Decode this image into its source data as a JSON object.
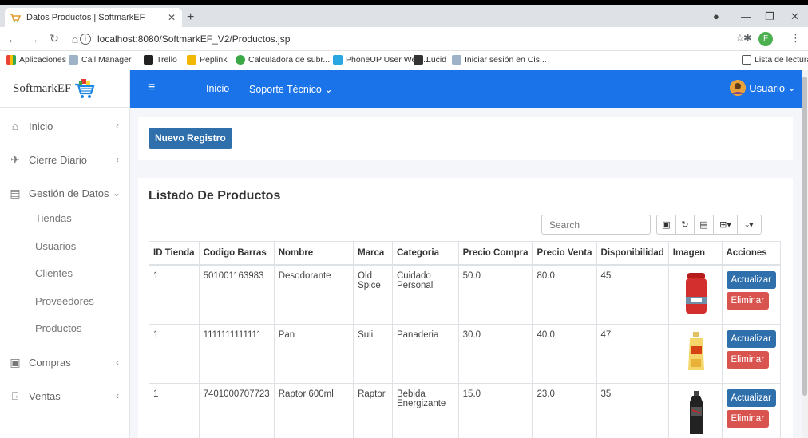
{
  "browser": {
    "tab_title": "Datos Productos | SoftmarkEF",
    "url": "localhost:8080/SoftmarkEF_V2/Productos.jsp",
    "profile_initial": "F",
    "bookmarks": [
      "Aplicaciones",
      "Call Manager",
      "Trello",
      "Peplink",
      "Calculadora de subr...",
      "PhoneUP User Web...",
      "Lucid",
      "Iniciar sesión en Cis..."
    ],
    "reading_list": "Lista de lectura"
  },
  "brand": "SoftmarkEF",
  "topnav": {
    "inicio": "Inicio",
    "soporte": "Soporte Técnico",
    "user": "Usuario"
  },
  "sidebar": {
    "inicio": "Inicio",
    "cierre": "Cierre Diario",
    "gestion": "Gestión de Datos",
    "subitems": [
      "Tiendas",
      "Usuarios",
      "Clientes",
      "Proveedores",
      "Productos"
    ],
    "compras": "Compras",
    "ventas": "Ventas"
  },
  "main": {
    "new_button": "Nuevo Registro",
    "list_title": "Listado De Productos",
    "search_placeholder": "Search"
  },
  "table": {
    "headers": [
      "ID Tienda",
      "Codigo Barras",
      "Nombre",
      "Marca",
      "Categoria",
      "Precio Compra",
      "Precio Venta",
      "Disponibilidad",
      "Imagen",
      "Acciones"
    ],
    "rows": [
      [
        "1",
        "501001163983",
        "Desodorante",
        "Old Spice",
        "Cuidado Personal",
        "50.0",
        "80.0",
        "45"
      ],
      [
        "1",
        "1111111111111",
        "Pan",
        "Suli",
        "Panaderia",
        "30.0",
        "40.0",
        "47"
      ],
      [
        "1",
        "7401000707723",
        "Raptor 600ml",
        "Raptor",
        "Bebida Energizante",
        "15.0",
        "23.0",
        "35"
      ]
    ],
    "actions": {
      "update": "Actualizar",
      "delete": "Eliminar"
    }
  },
  "colors": {
    "primary": "#1a73e8",
    "button_blue": "#2f6fac",
    "danger": "#d9534f"
  }
}
